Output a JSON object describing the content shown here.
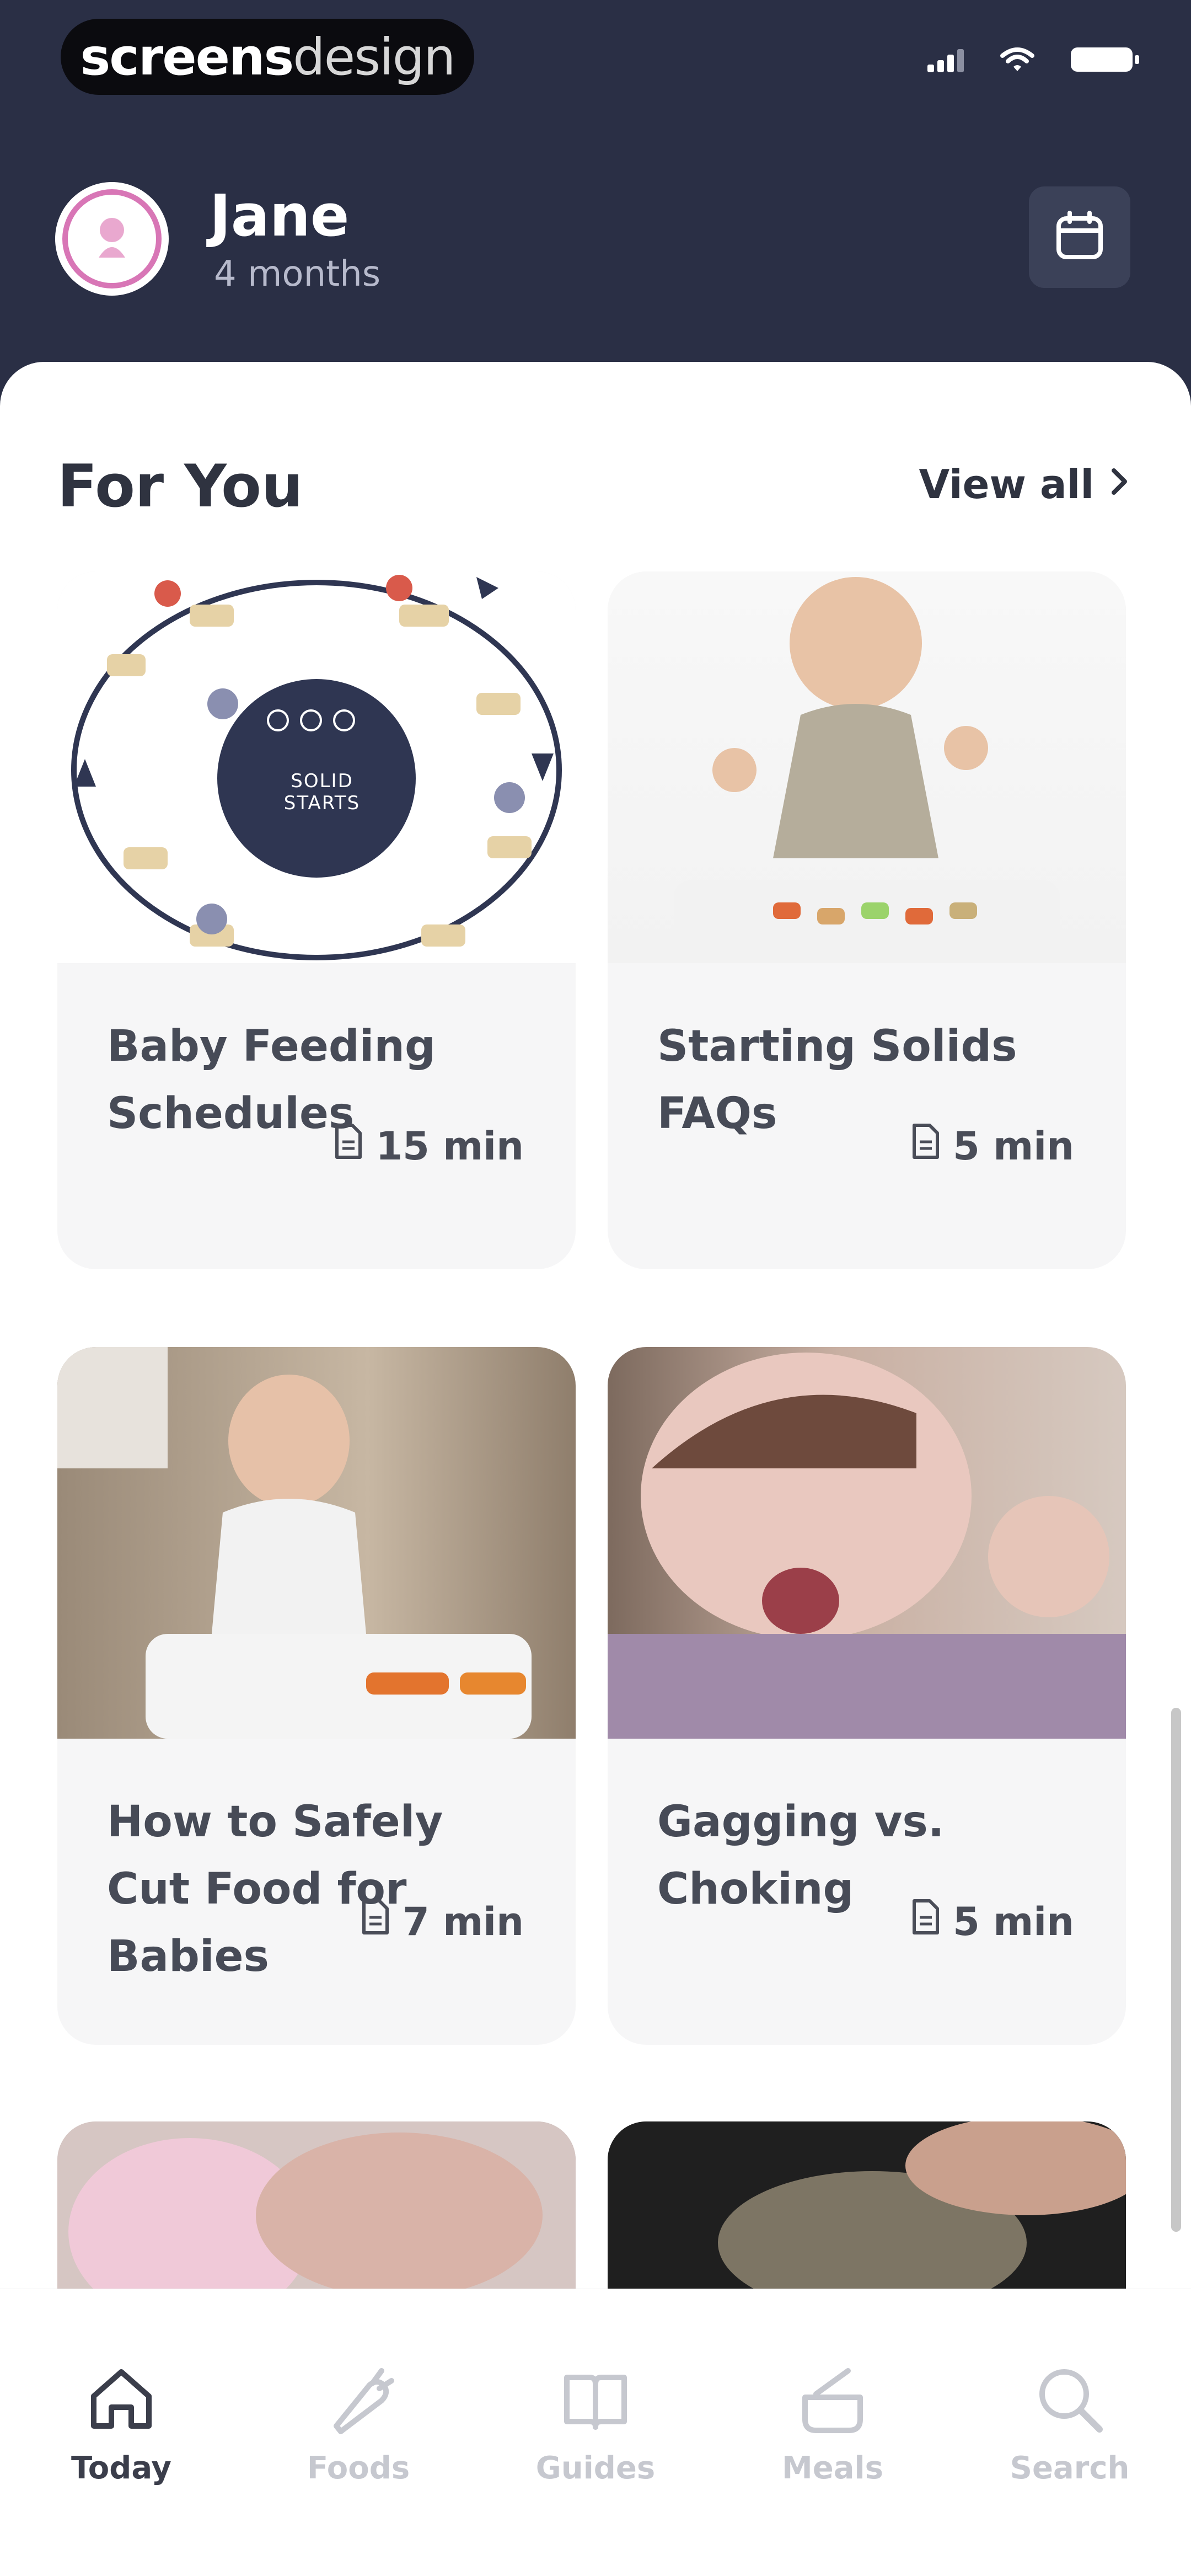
{
  "status_bar": {
    "badge_brand_bold": "screens",
    "badge_brand_light": "design"
  },
  "profile": {
    "name": "Jane",
    "age": "4 months"
  },
  "for_you": {
    "title": "For You",
    "view_all": "View all",
    "cards": [
      {
        "title": "Baby Feeding Schedules",
        "duration": "15 min"
      },
      {
        "title": "Starting Solids FAQs",
        "duration": "5 min"
      },
      {
        "title": "How to Safely Cut Food for Babies",
        "duration": "7 min"
      },
      {
        "title": "Gagging vs. Choking",
        "duration": "5 min"
      }
    ],
    "logo_text": "SOLID STARTS"
  },
  "tabs": [
    {
      "label": "Today",
      "icon": "home-icon",
      "active": true
    },
    {
      "label": "Foods",
      "icon": "carrot-icon",
      "active": false
    },
    {
      "label": "Guides",
      "icon": "book-icon",
      "active": false
    },
    {
      "label": "Meals",
      "icon": "bowl-icon",
      "active": false
    },
    {
      "label": "Search",
      "icon": "search-icon",
      "active": false
    }
  ],
  "colors": {
    "header_bg": "#2a2f45",
    "accent_pink": "#d876b6",
    "sheet_bg": "#ffffff",
    "card_bg": "#f6f6f7"
  }
}
